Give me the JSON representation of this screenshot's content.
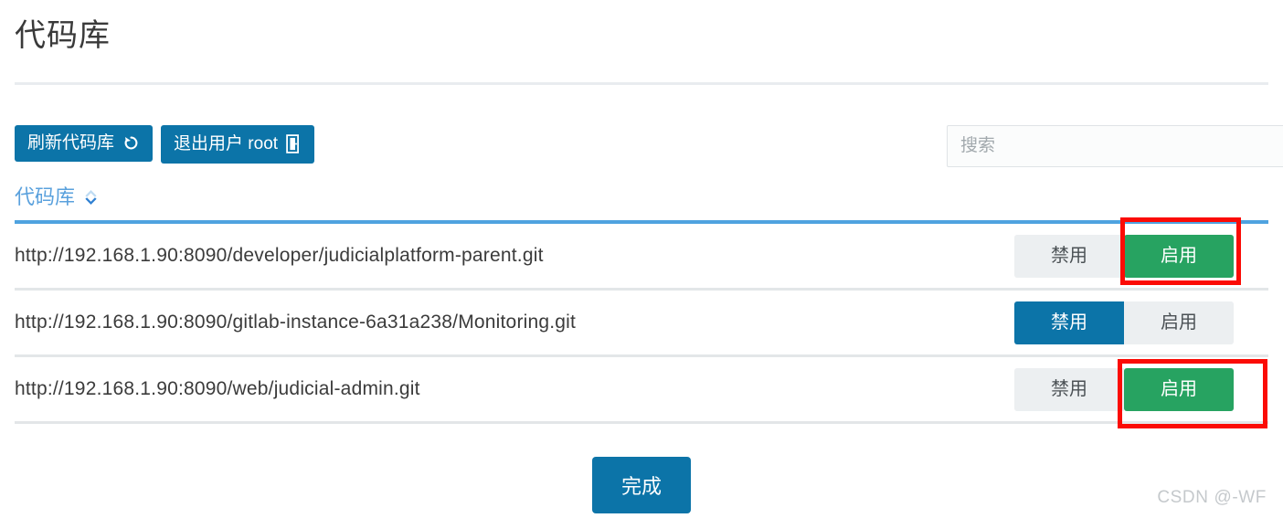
{
  "page": {
    "title": "代码库",
    "watermark": "CSDN @-WF"
  },
  "toolbar": {
    "refresh_label": "刷新代码库",
    "refresh_icon": "refresh-arrow-icon",
    "logout_label": "退出用户 root",
    "logout_icon": "sign-out-door-icon"
  },
  "search": {
    "placeholder": "搜索",
    "value": "",
    "icon": "search-icon"
  },
  "table": {
    "header": {
      "repo_column": "代码库",
      "sort_icon": "sort-updown-icon",
      "sort_state": "desc"
    },
    "toggle": {
      "disable_label": "禁用",
      "enable_label": "启用"
    },
    "rows": [
      {
        "url": "http://192.168.1.90:8090/developer/judicialplatform-parent.git",
        "state": "enabled",
        "highlight": "enable"
      },
      {
        "url": "http://192.168.1.90:8090/gitlab-instance-6a31a238/Monitoring.git",
        "state": "disabled",
        "highlight": "none"
      },
      {
        "url": "http://192.168.1.90:8090/web/judicial-admin.git",
        "state": "enabled",
        "highlight": "enable"
      }
    ]
  },
  "footer": {
    "done_label": "完成"
  },
  "colors": {
    "primary_blue": "#0c74a8",
    "active_green": "#27a361",
    "header_link_blue": "#5aa1dd",
    "header_underline": "#4fa3e0",
    "toggle_idle": "#eceff1",
    "annotation_red": "#fb0b05",
    "row_divider": "#e3e6e8",
    "watermark_gray": "#c5c9cc"
  }
}
